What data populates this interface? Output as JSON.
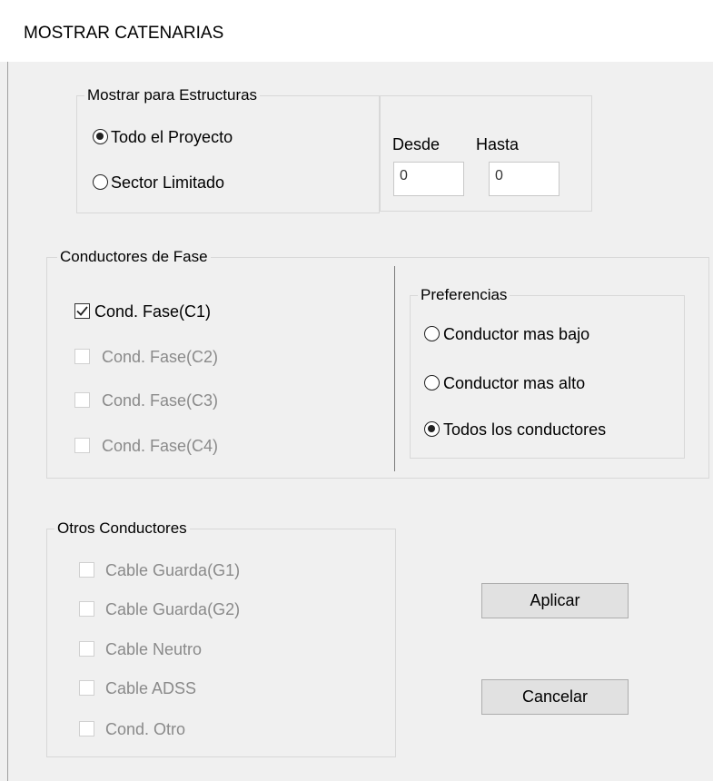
{
  "window": {
    "title": "MOSTRAR CATENARIAS"
  },
  "structures": {
    "legend": "Mostrar para Estructuras",
    "options": [
      {
        "label": "Todo el Proyecto",
        "selected": true
      },
      {
        "label": "Sector Limitado",
        "selected": false
      }
    ],
    "from_label": "Desde",
    "to_label": "Hasta",
    "from_value": "0",
    "to_value": "0"
  },
  "phase": {
    "legend": "Conductores de Fase",
    "items": [
      {
        "label": "Cond. Fase(C1)",
        "checked": true,
        "enabled": true
      },
      {
        "label": "Cond. Fase(C2)",
        "checked": false,
        "enabled": false
      },
      {
        "label": "Cond. Fase(C3)",
        "checked": false,
        "enabled": false
      },
      {
        "label": "Cond. Fase(C4)",
        "checked": false,
        "enabled": false
      }
    ]
  },
  "preferences": {
    "legend": "Preferencias",
    "options": [
      {
        "label": "Conductor mas bajo",
        "selected": false
      },
      {
        "label": "Conductor mas alto",
        "selected": false
      },
      {
        "label": "Todos los conductores",
        "selected": true
      }
    ]
  },
  "others": {
    "legend": "Otros Conductores",
    "items": [
      {
        "label": "Cable Guarda(G1)",
        "checked": false,
        "enabled": false
      },
      {
        "label": "Cable Guarda(G2)",
        "checked": false,
        "enabled": false
      },
      {
        "label": "Cable Neutro",
        "checked": false,
        "enabled": false
      },
      {
        "label": "Cable ADSS",
        "checked": false,
        "enabled": false
      },
      {
        "label": "Cond. Otro",
        "checked": false,
        "enabled": false
      }
    ]
  },
  "buttons": {
    "apply": "Aplicar",
    "cancel": "Cancelar"
  }
}
